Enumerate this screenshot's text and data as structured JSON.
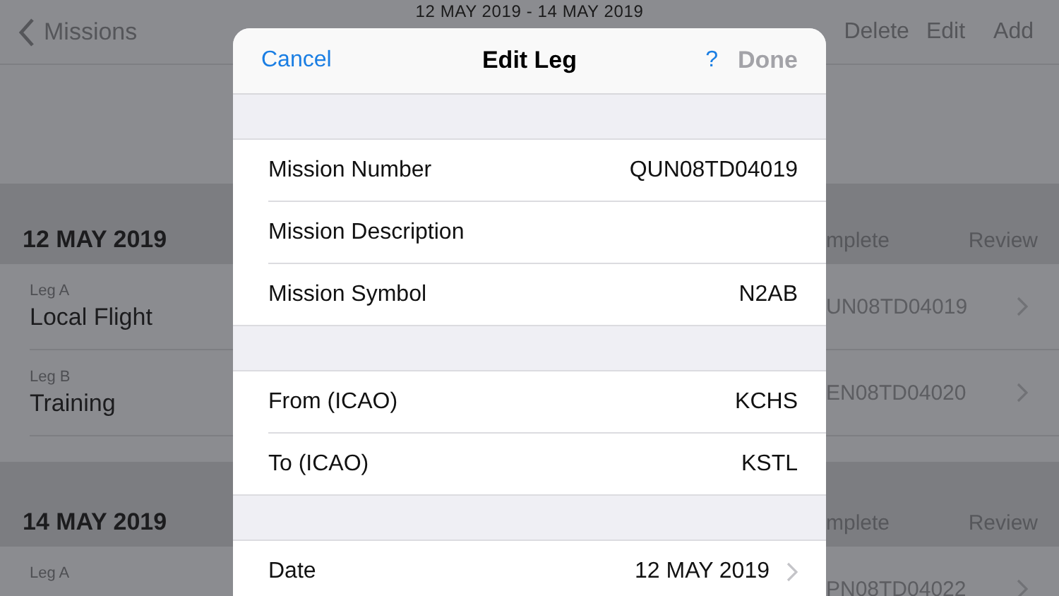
{
  "nav": {
    "back": "Missions",
    "title": "12 MAY 2019 - 14 MAY 2019",
    "actions": [
      "Delete",
      "Edit",
      "Add"
    ]
  },
  "sections": [
    {
      "date": "12 MAY 2019",
      "columns": [
        "mplete",
        "Review"
      ],
      "legs": [
        {
          "leg": "Leg A",
          "name": "Local Flight",
          "number": "UN08TD04019"
        },
        {
          "leg": "Leg B",
          "name": "Training",
          "number": "EN08TD04020"
        }
      ]
    },
    {
      "date": "14 MAY 2019",
      "columns": [
        "mplete",
        "Review"
      ],
      "legs": [
        {
          "leg": "Leg A",
          "number": "PN08TD04022"
        }
      ]
    }
  ],
  "modal": {
    "cancel": "Cancel",
    "title": "Edit Leg",
    "help": "?",
    "done": {
      "label": "Done",
      "disabled": true
    },
    "groups": [
      [
        {
          "kind": "plain",
          "label": "Mission Number",
          "value": "QUN08TD04019"
        },
        {
          "kind": "plain",
          "label": "Mission Description"
        },
        {
          "kind": "plain",
          "label": "Mission Symbol",
          "value": "N2AB"
        }
      ],
      [
        {
          "kind": "plain",
          "label": "From (ICAO)",
          "value": "KCHS"
        },
        {
          "kind": "plain",
          "label": "To (ICAO)",
          "value": "KSTL"
        }
      ],
      [
        {
          "kind": "disclosure",
          "label": "Date",
          "value": "12 MAY 2019"
        }
      ]
    ]
  }
}
